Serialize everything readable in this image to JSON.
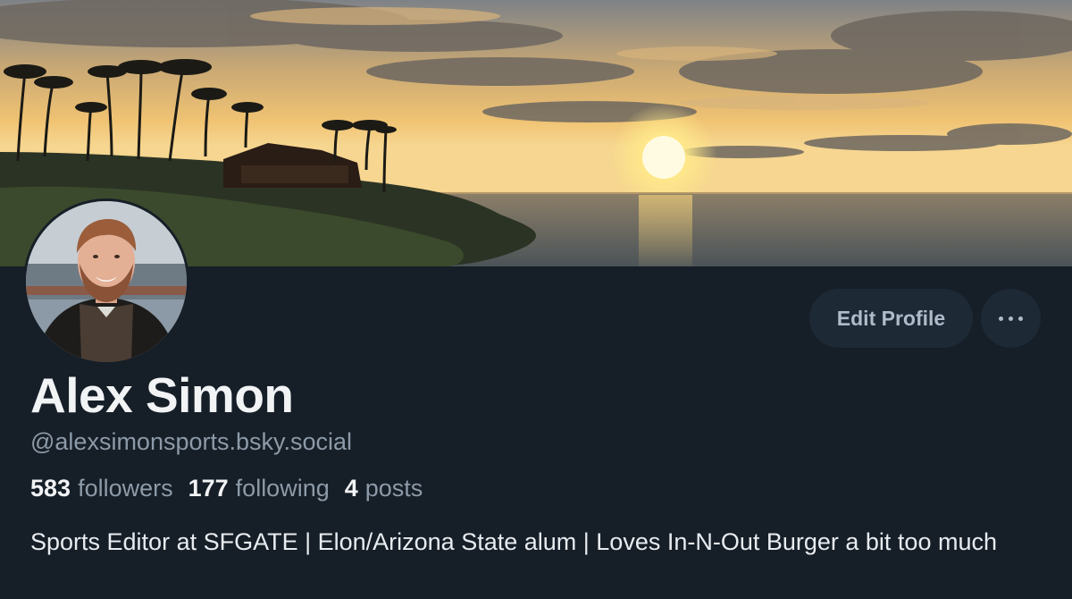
{
  "profile": {
    "display_name": "Alex Simon",
    "handle": "@alexsimonsports.bsky.social",
    "bio": "Sports Editor at SFGATE | Elon/Arizona State alum | Loves In-N-Out Burger a bit too much"
  },
  "stats": {
    "followers_count": "583",
    "followers_label": "followers",
    "following_count": "177",
    "following_label": "following",
    "posts_count": "4",
    "posts_label": "posts"
  },
  "actions": {
    "edit_label": "Edit Profile",
    "more_icon": "ellipsis-icon"
  },
  "theme": {
    "background": "#161e27",
    "button_bg": "#1e2936",
    "text_primary": "#f1f3f5",
    "text_secondary": "#8d9aa8"
  }
}
